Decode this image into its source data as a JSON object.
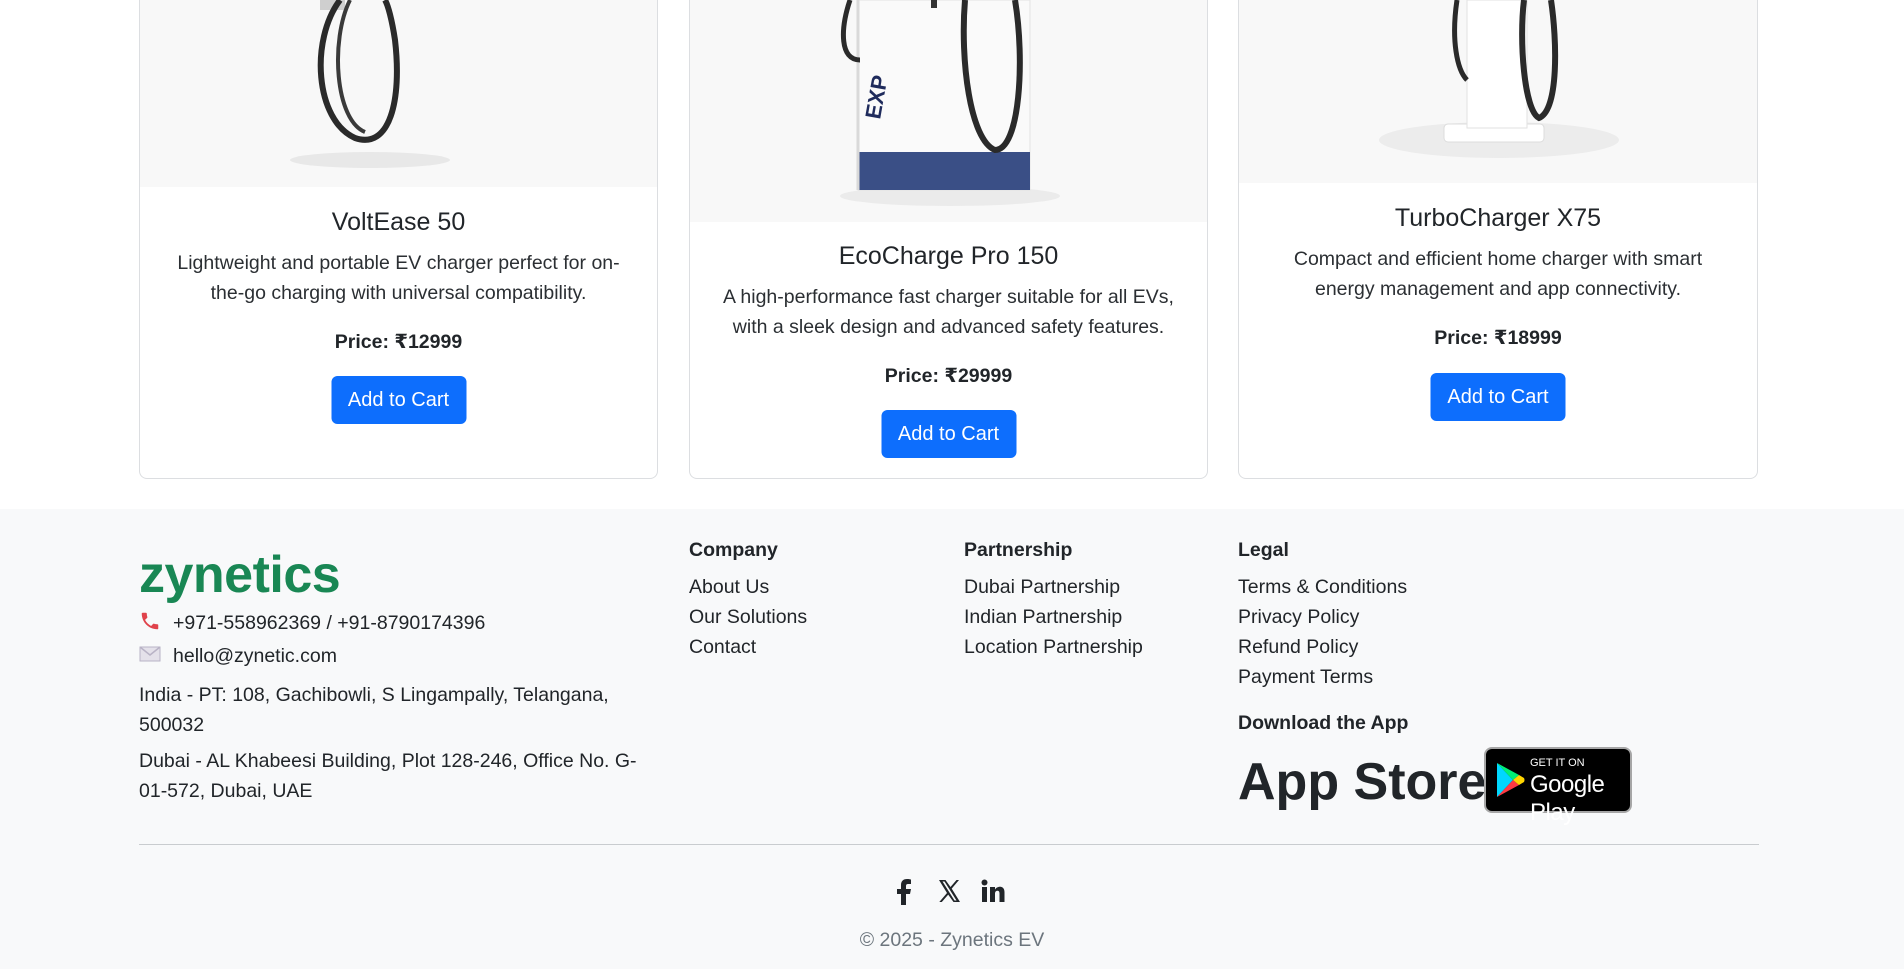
{
  "products": [
    {
      "title": "VoltEase 50",
      "description": "Lightweight and portable EV charger perfect for on-the-go charging with universal compatibility.",
      "price": "Price: ₹12999",
      "button": "Add to Cart"
    },
    {
      "title": "EcoCharge Pro 150",
      "description": "A high-performance fast charger suitable for all EVs, with a sleek design and advanced safety features.",
      "price": "Price: ₹29999",
      "button": "Add to Cart"
    },
    {
      "title": "TurboCharger X75",
      "description": "Compact and efficient home charger with smart energy management and app connectivity.",
      "price": "Price: ₹18999",
      "button": "Add to Cart"
    }
  ],
  "footer": {
    "brand": "zynetics",
    "phone": "+971-558962369 / +91-8790174396",
    "email": "hello@zynetic.com",
    "address_india": "India - PT: 108, Gachibowli, S Lingampally, Telangana, 500032",
    "address_dubai": "Dubai - AL Khabeesi Building, Plot 128-246, Office No. G-01-572, Dubai, UAE",
    "columns": [
      {
        "title": "Company",
        "links": [
          "About Us",
          "Our Solutions",
          "Contact"
        ]
      },
      {
        "title": "Partnership",
        "links": [
          "Dubai Partnership",
          "Indian Partnership",
          "Location Partnership"
        ]
      },
      {
        "title": "Legal",
        "links": [
          "Terms & Conditions",
          "Privacy Policy",
          "Refund Policy",
          "Payment Terms"
        ]
      }
    ],
    "download_title": "Download the App",
    "app_store_label": "App Store",
    "google_play": {
      "small": "GET IT ON",
      "large": "Google Play"
    },
    "social_icons": [
      "facebook-icon",
      "x-icon",
      "linkedin-icon"
    ],
    "copyright": "© 2025 - Zynetics EV"
  },
  "colors": {
    "primary": "#0d6efd",
    "brand": "#198754",
    "footer_bg": "#f8f9fa"
  }
}
